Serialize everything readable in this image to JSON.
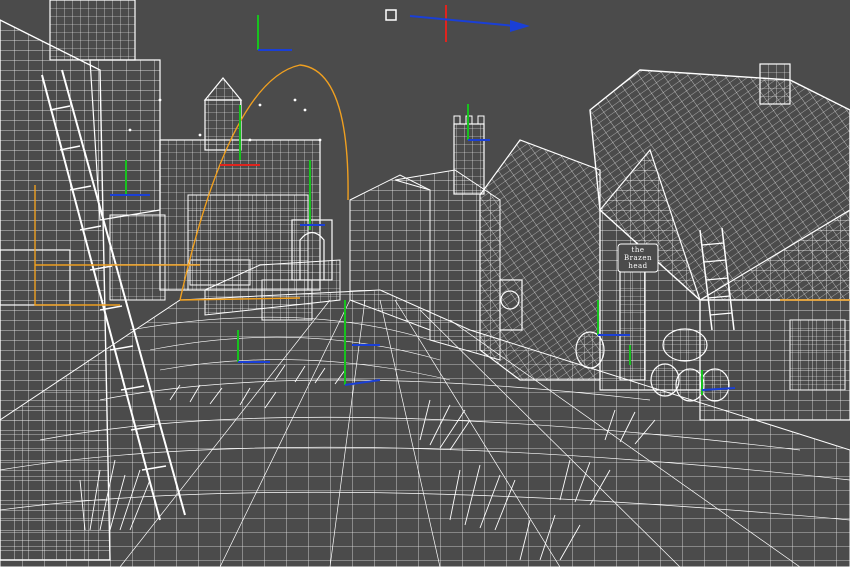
{
  "viewport": {
    "mode": "wireframe",
    "background_color": "#4b4b4b",
    "wire_color": "#ffffff"
  },
  "gizmo_colors": {
    "x_axis": "#1a3fd6",
    "y_axis": "#17c21e",
    "z_axis": "#e0241e",
    "selection": "#f0a020"
  },
  "scene_objects": {
    "left_building": "left-timber-house",
    "ladder_left": "leaning-ladder",
    "castle": "castle-keep",
    "right_tower": "church-tower",
    "tavern": "tavern-building",
    "barrels": "barrel-stack",
    "ground": "cobblestone-street",
    "grass": "grass-tufts"
  },
  "tavern_sign": {
    "line1": "the",
    "line2": "Brazen",
    "line3": "head"
  }
}
